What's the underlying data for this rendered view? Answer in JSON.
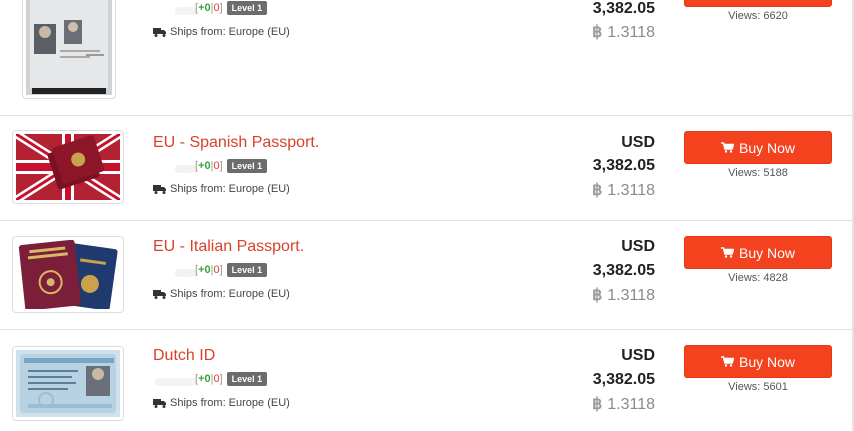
{
  "listings": [
    {
      "title": "",
      "score_pos": "+0",
      "score_neg": "0",
      "level": "Level 1",
      "ships_from": "Ships from: Europe (EU)",
      "currency": "",
      "price_fiat": "3,382.05",
      "btc_symbol": "฿",
      "price_btc": "1.3118",
      "buy_label": "",
      "views": "Views: 6620",
      "image": "passport-photo-page"
    },
    {
      "title": "EU - Spanish Passport.",
      "score_pos": "+0",
      "score_neg": "0",
      "level": "Level 1",
      "ships_from": "Ships from: Europe (EU)",
      "currency": "USD",
      "price_fiat": "3,382.05",
      "btc_symbol": "฿",
      "price_btc": "1.3118",
      "buy_label": "Buy Now",
      "views": "Views: 5188",
      "image": "spanish-passport"
    },
    {
      "title": "EU - Italian Passport.",
      "score_pos": "+0",
      "score_neg": "0",
      "level": "Level 1",
      "ships_from": "Ships from: Europe (EU)",
      "currency": "USD",
      "price_fiat": "3,382.05",
      "btc_symbol": "฿",
      "price_btc": "1.3118",
      "buy_label": "Buy Now",
      "views": "Views: 4828",
      "image": "italian-passport"
    },
    {
      "title": "Dutch ID",
      "score_pos": "+0",
      "score_neg": "0",
      "level": "Level 1",
      "ships_from": "Ships from: Europe (EU)",
      "currency": "USD",
      "price_fiat": "3,382.05",
      "btc_symbol": "฿",
      "price_btc": "1.3118",
      "buy_label": "Buy Now",
      "views": "Views: 5601",
      "image": "dutch-id-card"
    }
  ],
  "colors": {
    "accent": "#f4421e",
    "title": "#d9412b",
    "positive": "#3aa53a",
    "level_badge": "#6c6c6c"
  },
  "icons": {
    "truck": "truck-icon",
    "cart": "cart-icon"
  }
}
